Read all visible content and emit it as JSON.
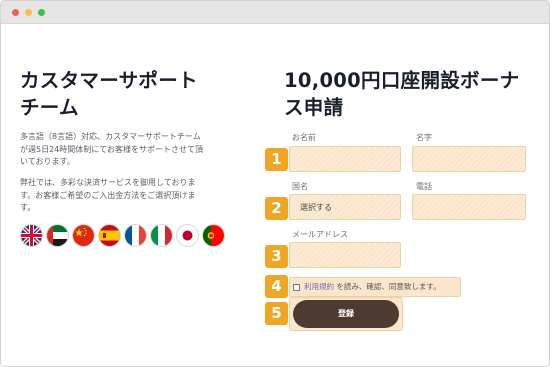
{
  "window": {
    "controls": [
      "close",
      "minimize",
      "zoom"
    ]
  },
  "support": {
    "title": "カスタマーサポート\nチーム",
    "paragraph1": "多言語（8言語）対応、カスタマーサポートチーム\nが週5日24時間体制にてお客様をサポートさせて頂\nいております。",
    "paragraph2": "弊社では、多彩な決済サービスを御用しておりま\nす。お客様ご希望のご入出金方法をご選択頂けま\nす。",
    "flags": [
      "uk-flag",
      "uae-flag",
      "china-flag",
      "spain-flag",
      "france-flag",
      "italy-flag",
      "japan-flag",
      "portugal-flag"
    ]
  },
  "form": {
    "title": "10,000円口座開設ボーナ\nス申請",
    "steps": [
      "1",
      "2",
      "3",
      "4",
      "5"
    ],
    "last_name_label": "お名前",
    "first_name_label": "名字",
    "country_label": "国名",
    "country_value": "選択する",
    "phone_label": "電話",
    "email_label": "メールアドレス",
    "terms_link": "利用規約",
    "terms_text": " を読み、確認、同意致します。",
    "submit_label": "登録"
  },
  "colors": {
    "accent_orange": "#f0a624",
    "field_bg": "#fbe6cb",
    "button_brown": "#4d3b32",
    "heading": "#1a1f2e"
  }
}
